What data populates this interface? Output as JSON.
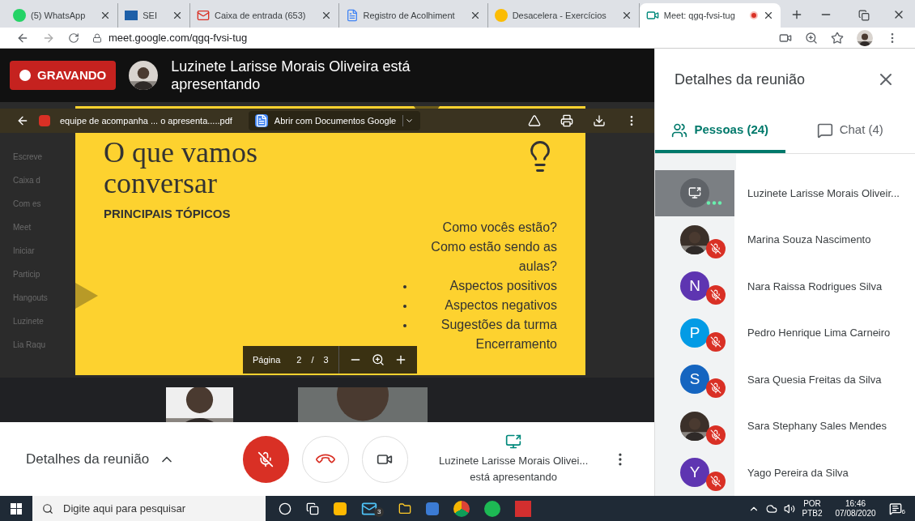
{
  "browser": {
    "tabs": [
      {
        "label": "(5) WhatsApp",
        "selected": false,
        "recording": false
      },
      {
        "label": "SEI",
        "selected": false,
        "recording": false
      },
      {
        "label": "Caixa de entrada (653)",
        "selected": false,
        "recording": false
      },
      {
        "label": "Registro de Acolhiment",
        "selected": false,
        "recording": false
      },
      {
        "label": "Desacelera - Exercícios",
        "selected": false,
        "recording": false
      },
      {
        "label": "Meet: qgq-fvsi-tug",
        "selected": true,
        "recording": true
      }
    ],
    "url": "meet.google.com/qgq-fvsi-tug"
  },
  "header": {
    "recording_label": "GRAVANDO",
    "presenter_title": "Luzinete Larisse Morais Oliveira está apresentando"
  },
  "background_sidebar": [
    "Escreve",
    "Caixa d",
    "Com es",
    "Meet",
    "Iniciar",
    "Particip",
    "Hangouts",
    "Luzinete",
    "Lia Raqu"
  ],
  "pdf_viewer": {
    "file_name": "equipe de acompanha ... o apresenta.....pdf",
    "open_with": "Abrir com Documentos Google",
    "slide": {
      "title": "O que vamos conversar",
      "subtitle": "PRINCIPAIS TÓPICOS",
      "items": [
        {
          "text": "Como vocês estão?",
          "kind": "plain"
        },
        {
          "text": "Como estão sendo as aulas?",
          "kind": "plain"
        },
        {
          "text": "Aspectos positivos",
          "kind": "bullet"
        },
        {
          "text": "Aspectos negativos",
          "kind": "bullet"
        },
        {
          "text": "Sugestões da turma",
          "kind": "bullet"
        },
        {
          "text": "Encerramento",
          "kind": "plain"
        }
      ]
    },
    "page_label": "Página",
    "page": "2",
    "page_separator": "/",
    "page_count": "3"
  },
  "bottom_bar": {
    "details_label": "Detalhes da reunião",
    "mic_muted": true,
    "presenter_name": "Luzinete Larisse Morais Olivei...",
    "presenter_status": "está apresentando"
  },
  "panel": {
    "title": "Detalhes da reunião",
    "tabs": [
      {
        "label": "Pessoas (24)",
        "kind": "people",
        "selected": true
      },
      {
        "label": "Chat (4)",
        "kind": "chat",
        "selected": false
      }
    ],
    "participants": [
      {
        "name": "Luzinete Larisse Morais Oliveir...",
        "kind": "presenting",
        "presenting": true,
        "muted": false
      },
      {
        "name": "Marina Souza Nascimento",
        "presenting": false,
        "muted": true
      },
      {
        "name": "Nara Raissa Rodrigues Silva",
        "kind": "letter",
        "letter": "N",
        "color": "#5e35b1",
        "presenting": false,
        "muted": true
      },
      {
        "name": "Pedro Henrique Lima Carneiro",
        "kind": "letter",
        "letter": "P",
        "color": "#039be5",
        "presenting": false,
        "muted": true
      },
      {
        "name": "Sara Quesia Freitas da Silva",
        "kind": "letter",
        "letter": "S",
        "color": "#1565c0",
        "presenting": false,
        "muted": true
      },
      {
        "name": "Sara Stephany Sales Mendes",
        "presenting": false,
        "muted": true
      },
      {
        "name": "Yago Pereira da Silva",
        "kind": "letter",
        "letter": "Y",
        "color": "#5e35b1",
        "presenting": false,
        "muted": true
      }
    ]
  },
  "taskbar": {
    "search_placeholder": "Digite aqui para pesquisar",
    "mail_badge": "3",
    "language": "POR",
    "layout": "PTB2",
    "time": "16:46",
    "date": "07/08/2020",
    "notifications": "6"
  }
}
